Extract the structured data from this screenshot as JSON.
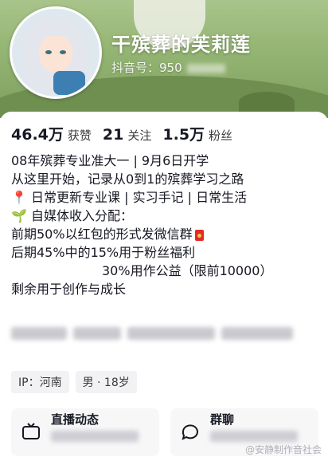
{
  "profile": {
    "name": "干殡葬的芙莉莲",
    "douyin_id_label": "抖音号：950"
  },
  "stats": [
    {
      "value": "46.4万",
      "label": "获赞"
    },
    {
      "value": "21",
      "label": "关注"
    },
    {
      "value": "1.5万",
      "label": "粉丝"
    }
  ],
  "bio": {
    "line1": "08年殡葬专业准大一 | 9月6日开学",
    "line2": "从这里开始，记录从0到1的殡葬学习之路",
    "line3": "日常更新专业课 | 实习手记 | 日常生活",
    "line4": "自媒体收入分配：",
    "line5": "前期50%以红包的形式发微信群",
    "line6": "后期45%中的15%用于粉丝福利",
    "line7": "30%用作公益（限前10000）",
    "line8": "剩余用于创作与成长",
    "pin_emoji": "📍",
    "sprout_emoji": "🌱"
  },
  "tags": {
    "ip": "IP：河南",
    "gender_age": "男 · 18岁"
  },
  "entries": {
    "live": "直播动态",
    "group": "群聊"
  },
  "watermark": "@安静制作音社会",
  "colors": {
    "banner": "#93b472",
    "text": "#161823",
    "tag_bg": "#f2f2f4"
  }
}
